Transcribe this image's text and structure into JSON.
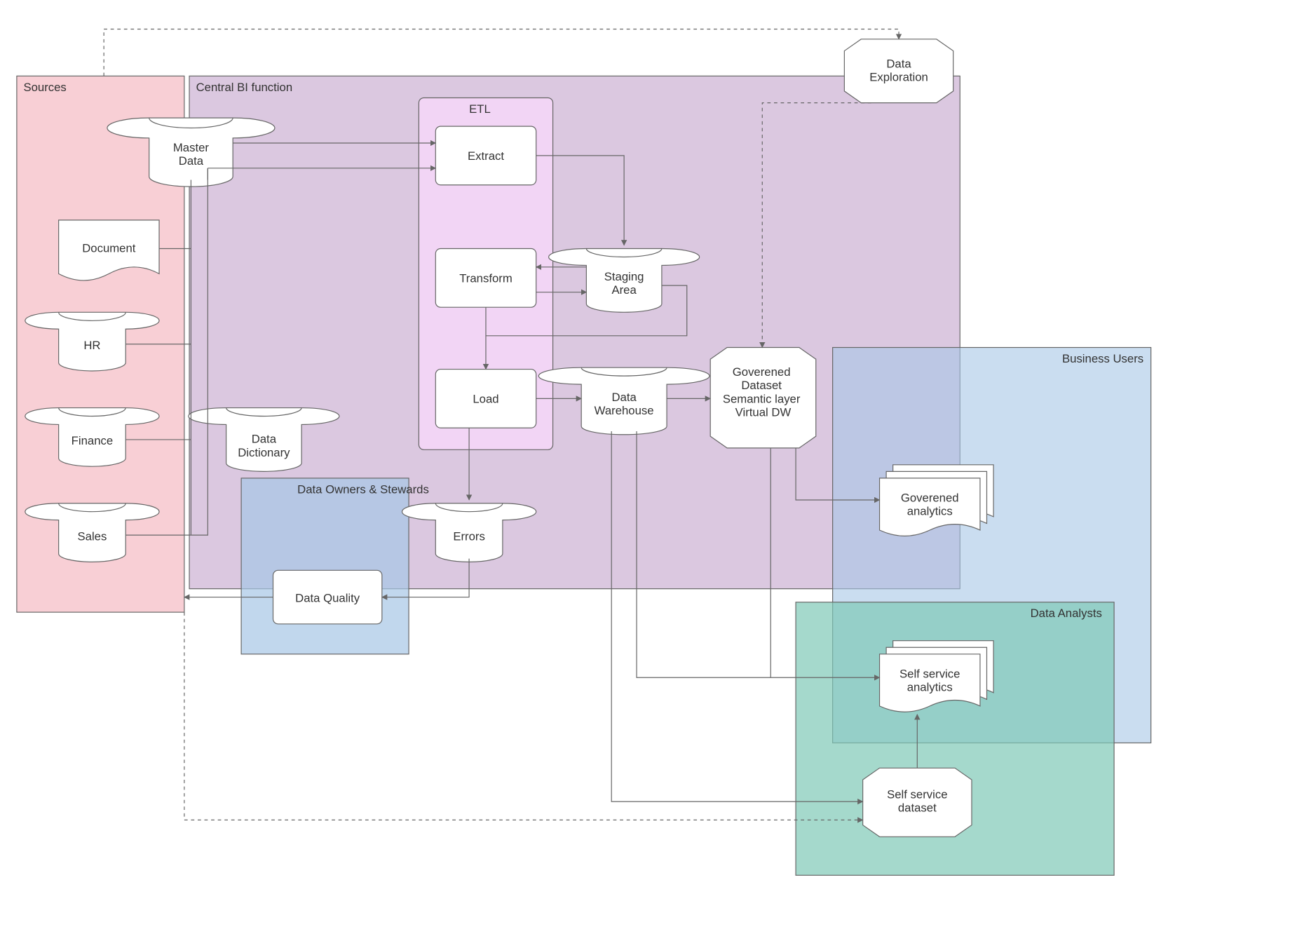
{
  "regions": {
    "sources": {
      "label": "Sources",
      "fill": "#f7c7ce",
      "opacity": 0.85
    },
    "central": {
      "label": "Central BI function",
      "fill": "#cfb6d6",
      "opacity": 0.75
    },
    "etl": {
      "label": "ETL",
      "fill": "#f4d6f7",
      "opacity": 0.9
    },
    "owners": {
      "label": "Data Owners & Stewards",
      "fill": "#a7c6e6",
      "opacity": 0.7
    },
    "business": {
      "label": "Business Users",
      "fill": "#a7c6e6",
      "opacity": 0.6
    },
    "analysts": {
      "label": "Data Analysts",
      "fill": "#7fc9b6",
      "opacity": 0.7
    }
  },
  "nodes": {
    "master_data": {
      "label": "Master Data"
    },
    "document": {
      "label": "Document"
    },
    "hr": {
      "label": "HR"
    },
    "finance": {
      "label": "Finance"
    },
    "sales": {
      "label": "Sales"
    },
    "data_dictionary": {
      "label": "Data Dictionary"
    },
    "extract": {
      "label": "Extract"
    },
    "transform": {
      "label": "Transform"
    },
    "load": {
      "label": "Load"
    },
    "staging": {
      "label": "Staging Area"
    },
    "warehouse": {
      "label": "Data Warehouse"
    },
    "errors": {
      "label": "Errors"
    },
    "data_quality": {
      "label": "Data Quality"
    },
    "governed_dataset": {
      "label": "Goverened Dataset Semantic layer Virtual DW"
    },
    "gov_analytics": {
      "label": "Goverened analytics"
    },
    "ss_analytics": {
      "label": "Self service analytics"
    },
    "ss_dataset": {
      "label": "Self service dataset"
    },
    "data_exploration": {
      "label": "Data Exploration"
    }
  }
}
